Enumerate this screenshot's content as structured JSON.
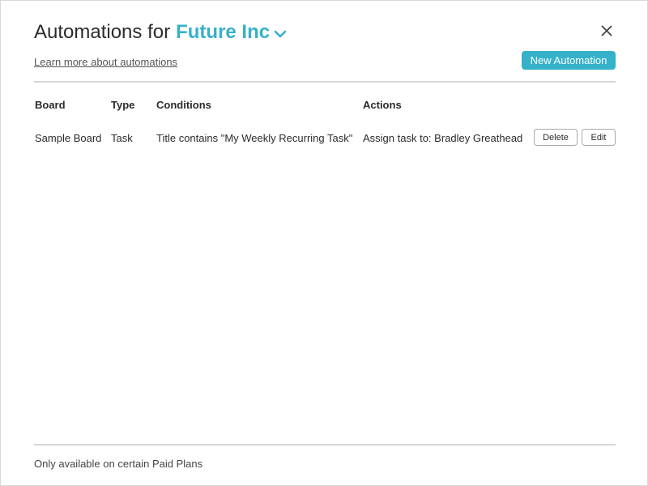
{
  "header": {
    "title_prefix": "Automations for",
    "org_name": "Future Inc",
    "org_dropdown_icon": "chevron-down-icon",
    "close_icon": "close-icon",
    "learn_more_link": "Learn more about automations",
    "new_button_label": "New Automation"
  },
  "table": {
    "columns": [
      "Board",
      "Type",
      "Conditions",
      "Actions"
    ],
    "rows": [
      {
        "board": "Sample Board",
        "type": "Task",
        "conditions": "Title contains \"My Weekly Recurring Task\"",
        "actions": "Assign task to: Bradley Greathead",
        "delete_label": "Delete",
        "edit_label": "Edit"
      }
    ]
  },
  "footer": {
    "note": "Only available on certain Paid Plans"
  },
  "colors": {
    "accent": "#35b1c9",
    "text": "#2b2b2b",
    "divider": "#d6d6d6"
  }
}
